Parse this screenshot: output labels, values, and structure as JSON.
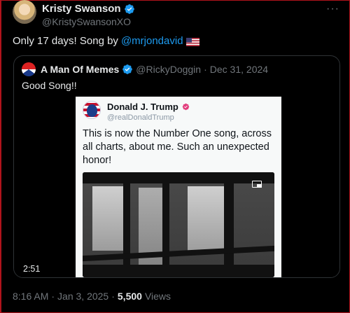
{
  "author": {
    "name": "Kristy Swanson",
    "handle": "@KristySwansonXO"
  },
  "tweet": {
    "text": "Only 17 days! Song by",
    "mention": "@mrjondavid"
  },
  "more_menu": "···",
  "quoted": {
    "name": "A Man Of Memes",
    "handle": "@RickyDoggin",
    "separator": "·",
    "date": "Dec 31, 2024",
    "text": "Good Song!!"
  },
  "embedded_card": {
    "name": "Donald J. Trump",
    "handle": "@realDonaldTrump",
    "text": "This is now the Number One song, across all charts, about me. Such an unexpected honor!"
  },
  "video": {
    "duration": "2:51"
  },
  "meta": {
    "time": "8:16 AM",
    "separator1": "·",
    "date": "Jan 3, 2025",
    "separator2": "·",
    "views_count": "5,500",
    "views_label": "Views"
  },
  "colors": {
    "accent": "#1d9bf0",
    "text": "#e7e9ea",
    "muted": "#71767b",
    "background": "#000000"
  }
}
